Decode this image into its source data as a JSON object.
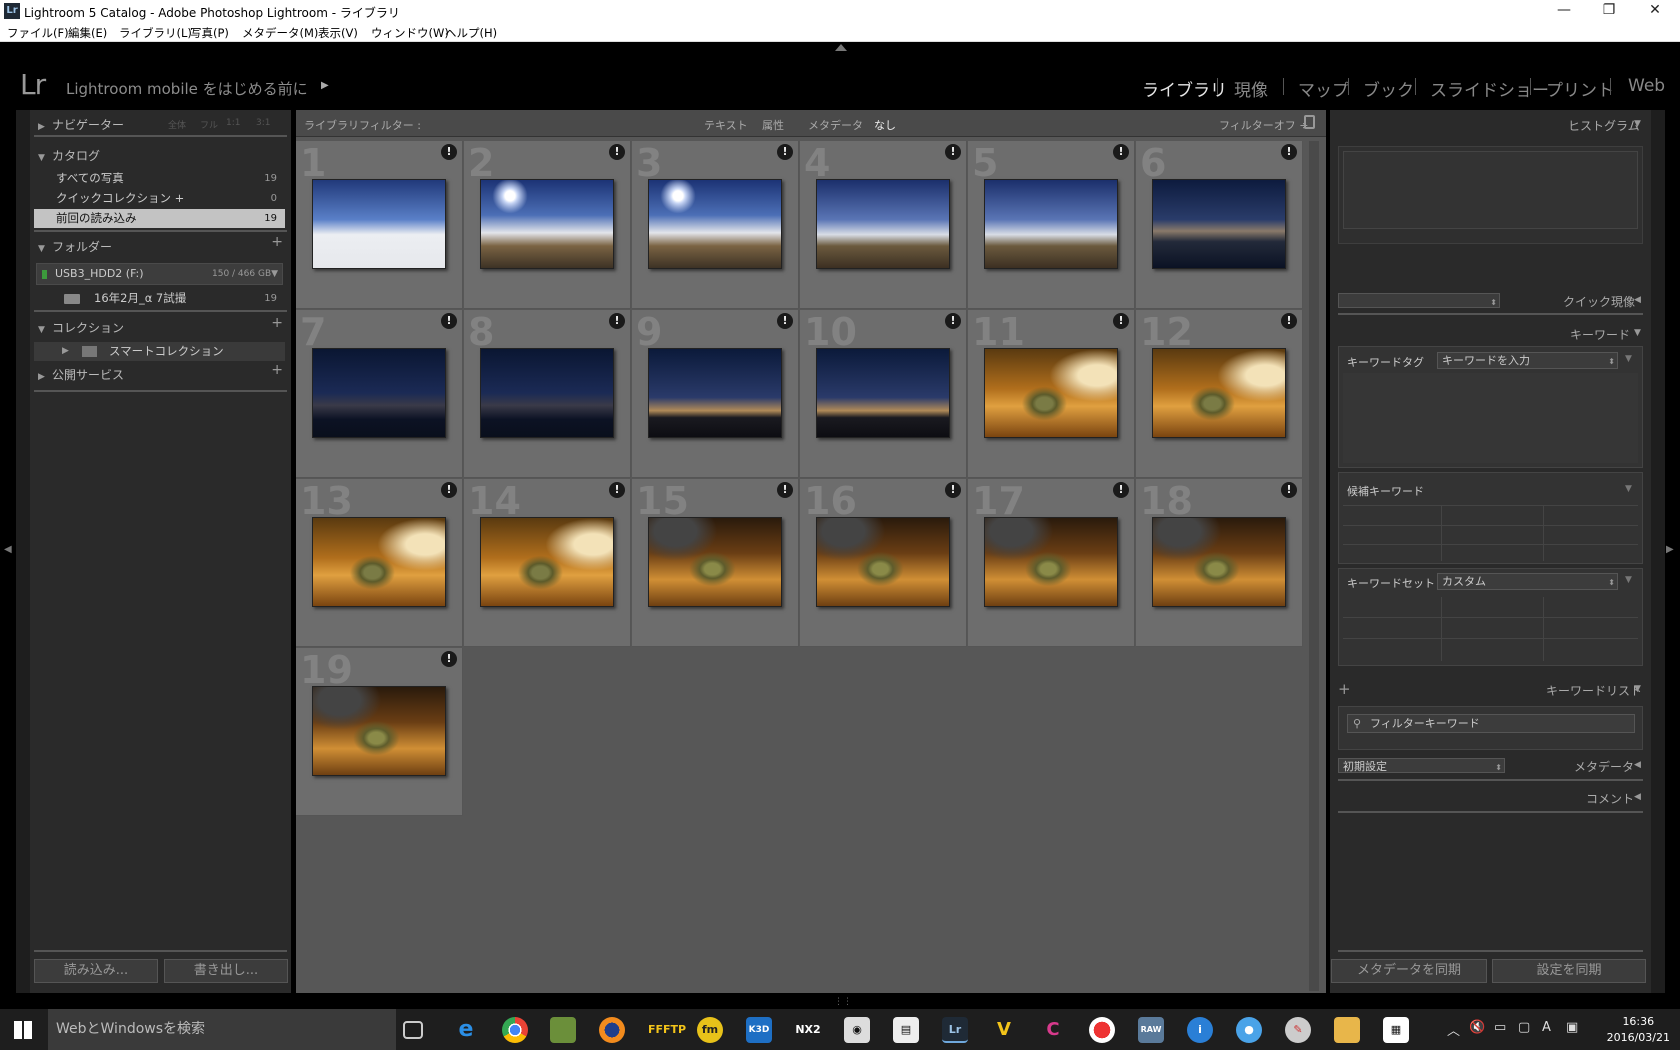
{
  "window": {
    "title": "Lightroom 5 Catalog - Adobe Photoshop Lightroom - ライブラリ",
    "logo": "Lr"
  },
  "menu": [
    "ファイル(F)",
    "編集(E)",
    "ライブラリ(L)",
    "写真(P)",
    "メタデータ(M)",
    "表示(V)",
    "ウィンドウ(W)",
    "ヘルプ(H)"
  ],
  "identity": {
    "logo": "Lr",
    "mobile": "Lightroom mobile をはじめる前に"
  },
  "modules": [
    "ライブラリ",
    "現像",
    "マップ",
    "ブック",
    "スライドショー",
    "プリント",
    "Web"
  ],
  "left": {
    "navigator": {
      "label": "ナビゲーター",
      "zoom": [
        "全体",
        "フル",
        "1:1",
        "3:1"
      ]
    },
    "catalog": {
      "label": "カタログ",
      "items": [
        {
          "label": "すべての写真",
          "count": "19"
        },
        {
          "label": "クイックコレクション +",
          "count": "0"
        },
        {
          "label": "前回の読み込み",
          "count": "19"
        }
      ]
    },
    "folders": {
      "label": "フォルダー",
      "volume": "USB3_HDD2 (F:)",
      "volume_size": "150 / 466 GB",
      "folder": "16年2月_α 7試撮",
      "folder_count": "19"
    },
    "collections": {
      "label": "コレクション",
      "smart": "スマートコレクション"
    },
    "publish": {
      "label": "公開サービス"
    },
    "import_btn": "読み込み...",
    "export_btn": "書き出し..."
  },
  "filter": {
    "label": "ライブラリフィルター :",
    "text": "テキスト",
    "attr": "属性",
    "meta": "メタデータ",
    "none": "なし",
    "off": "フィルターオフ ÷"
  },
  "grid": [
    {
      "num": "1",
      "style": "snow"
    },
    {
      "num": "2",
      "style": "sky2"
    },
    {
      "num": "3",
      "style": "sky2"
    },
    {
      "num": "4",
      "style": "sky"
    },
    {
      "num": "5",
      "style": "sky"
    },
    {
      "num": "6",
      "style": "dusk"
    },
    {
      "num": "7",
      "style": "night"
    },
    {
      "num": "8",
      "style": "night"
    },
    {
      "num": "9",
      "style": "night2"
    },
    {
      "num": "10",
      "style": "night2"
    },
    {
      "num": "11",
      "style": "plane"
    },
    {
      "num": "12",
      "style": "plane"
    },
    {
      "num": "13",
      "style": "plane"
    },
    {
      "num": "14",
      "style": "plane"
    },
    {
      "num": "15",
      "style": "plane2"
    },
    {
      "num": "16",
      "style": "plane2"
    },
    {
      "num": "17",
      "style": "plane2"
    },
    {
      "num": "18",
      "style": "plane2"
    },
    {
      "num": "19",
      "style": "plane2"
    }
  ],
  "right": {
    "histogram": "ヒストグラム",
    "quick_develop": "クイック現像",
    "keywording": "キーワード",
    "keyword_tag_label": "キーワードタグ",
    "keyword_tag_value": "キーワードを入力",
    "suggestions": "候補キーワード",
    "keyword_set_label": "キーワードセット",
    "keyword_set_value": "カスタム",
    "keyword_list": "キーワードリスト",
    "filter_keywords": "フィルターキーワード",
    "metadata_preset": "初期設定",
    "metadata": "メタデータ",
    "comments": "コメント",
    "sync_metadata": "メタデータを同期",
    "sync_settings": "設定を同期"
  },
  "taskbar": {
    "search": "WebとWindowsを検索",
    "time": "16:36",
    "date": "2016/03/21",
    "ime": "A"
  }
}
